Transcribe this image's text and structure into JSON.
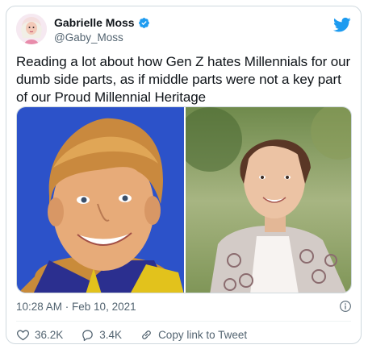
{
  "author": {
    "name": "Gabrielle Moss",
    "handle": "@Gaby_Moss",
    "verified": true
  },
  "tweet": {
    "text": "Reading a lot about how Gen Z hates Millennials for our dumb side parts, as if middle parts were not a key part of our Proud Millennial Heritage",
    "timestamp": "10:28 AM · Feb 10, 2021"
  },
  "media": {
    "photos": [
      "photo-left",
      "photo-right"
    ]
  },
  "actions": {
    "likes": "36.2K",
    "replies": "3.4K",
    "copy_link": "Copy link to Tweet"
  },
  "colors": {
    "brand": "#1d9bf0",
    "text": "#0f1419",
    "secondary": "#536471",
    "border": "#cfd9de"
  },
  "icons": [
    "verified-icon",
    "twitter-bird-icon",
    "info-icon",
    "heart-icon",
    "reply-icon",
    "link-icon"
  ]
}
